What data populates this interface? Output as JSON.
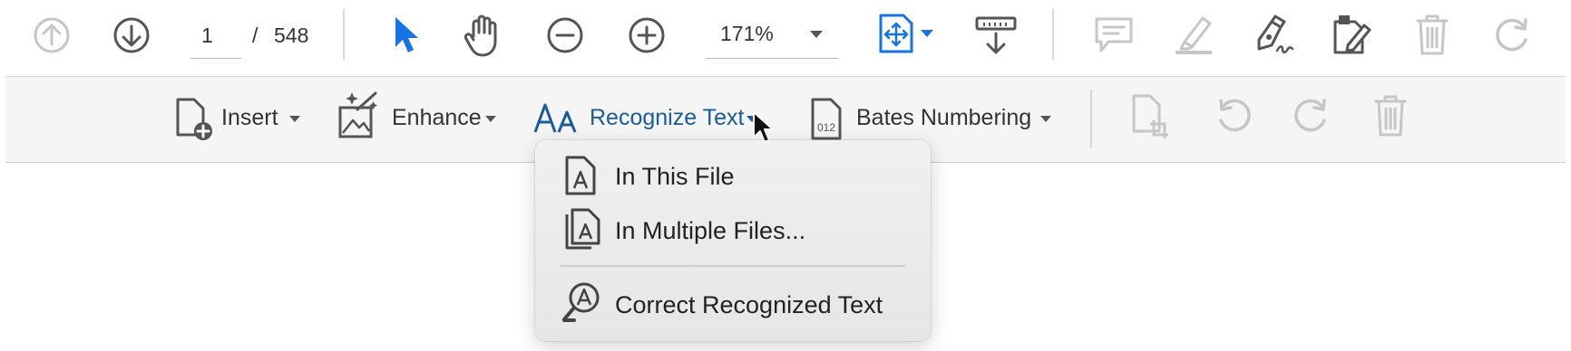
{
  "toolbar": {
    "page_current": "1",
    "page_separator": "/",
    "page_total": "548",
    "zoom": "171%"
  },
  "tools": {
    "insert_label": "Insert",
    "enhance_label": "Enhance",
    "recognize_label": "Recognize Text",
    "bates_label": "Bates Numbering",
    "bates_icon_text": "012"
  },
  "menu": {
    "items": [
      {
        "label": "In This File"
      },
      {
        "label": "In Multiple Files..."
      },
      {
        "label": "Correct Recognized Text"
      }
    ]
  },
  "colors": {
    "accent": "#1473e6",
    "recognize_text": "#1a5b9c",
    "disabled": "#c9c9c9"
  }
}
